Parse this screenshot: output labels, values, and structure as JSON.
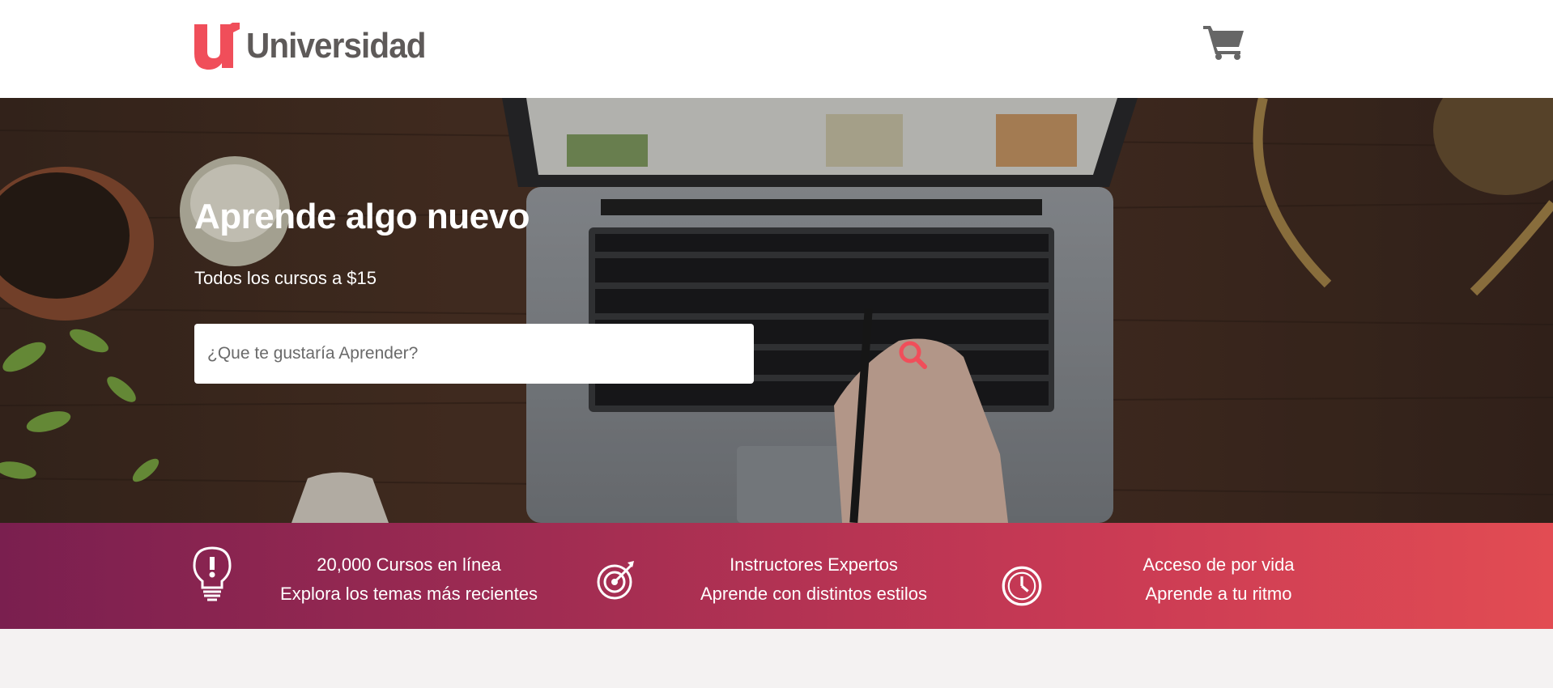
{
  "header": {
    "logo_text": "Universidad",
    "logo_icon": "u-logo-icon",
    "cart_icon": "shopping-cart-icon"
  },
  "hero": {
    "title": "Aprende algo nuevo",
    "subtitle": "Todos los cursos a $15",
    "search": {
      "placeholder": "¿Que te gustaría Aprender?",
      "value": "",
      "icon": "search-icon"
    }
  },
  "features": [
    {
      "icon": "lightbulb-icon",
      "line1": "20,000 Cursos en línea",
      "line2": "Explora los temas más recientes"
    },
    {
      "icon": "target-icon",
      "line1": "Instructores Expertos",
      "line2": "Aprende con distintos estilos"
    },
    {
      "icon": "clock-icon",
      "line1": "Acceso de por vida",
      "line2": "Aprende a tu ritmo"
    }
  ],
  "colors": {
    "brand": "#f04e5a",
    "logo_text": "#5e5a59",
    "gradient_start": "#7a1f4f",
    "gradient_end": "#e24c53"
  }
}
